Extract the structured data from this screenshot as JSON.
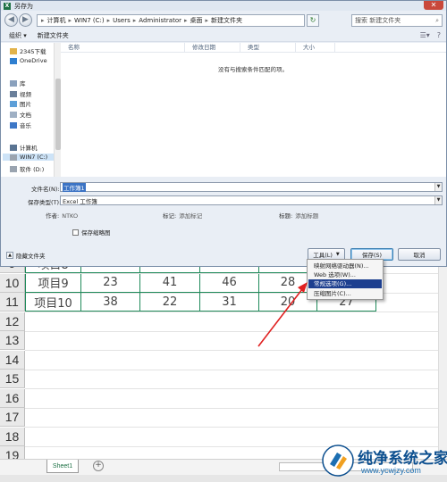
{
  "dialog": {
    "title": "另存为",
    "close_glyph": "✕",
    "address": [
      "计算机",
      "WIN7 (C:)",
      "Users",
      "Administrator",
      "桌面",
      "新建文件夹"
    ],
    "search_placeholder": "搜索 新建文件夹",
    "toolbar": {
      "organize": "组织 ▾",
      "new_folder": "新建文件夹"
    },
    "nav_items": [
      {
        "label": "2345下载",
        "icon": "folder-icon"
      },
      {
        "label": "OneDrive",
        "icon": "cloud-icon"
      },
      {
        "label": "库",
        "icon": "library-icon"
      },
      {
        "label": "视频",
        "icon": "video-icon"
      },
      {
        "label": "图片",
        "icon": "picture-icon"
      },
      {
        "label": "文档",
        "icon": "document-icon"
      },
      {
        "label": "音乐",
        "icon": "music-icon"
      },
      {
        "label": "计算机",
        "icon": "computer-icon"
      },
      {
        "label": "WIN7 (C:)",
        "icon": "drive-icon"
      },
      {
        "label": "软件 (D:)",
        "icon": "drive-icon"
      }
    ],
    "columns": [
      "名称",
      "修改日期",
      "类型",
      "大小"
    ],
    "empty_message": "没有与搜索条件匹配的项。",
    "filename_label": "文件名(N):",
    "filename_value": "工作簿1",
    "filetype_label": "保存类型(T):",
    "filetype_value": "Excel 工作簿",
    "author_label": "作者:",
    "author_value": "NTKO",
    "tags_label": "标记:",
    "tags_value": "添加标记",
    "titlemeta_label": "标题:",
    "titlemeta_value": "添加标题",
    "thumbnail_label": "保存缩略图",
    "hide_folders": "隐藏文件夹",
    "tools_button": "工具(L)",
    "save_button": "保存(S)",
    "cancel_button": "取消"
  },
  "tools_menu": [
    "映射网络驱动器(N)...",
    "Web 选项(W)...",
    "常规选项(G)...",
    "压缩图片(C)..."
  ],
  "sheet": {
    "rows": [
      {
        "num": "9",
        "cells": [
          "项目8",
          "41",
          "32",
          "25",
          "31"
        ]
      },
      {
        "num": "10",
        "cells": [
          "项目9",
          "23",
          "41",
          "46",
          "28"
        ]
      },
      {
        "num": "11",
        "cells": [
          "项目10",
          "38",
          "22",
          "31",
          "20",
          "27"
        ]
      },
      {
        "num": "12",
        "cells": []
      },
      {
        "num": "13",
        "cells": []
      },
      {
        "num": "14",
        "cells": []
      },
      {
        "num": "15",
        "cells": []
      },
      {
        "num": "16",
        "cells": []
      },
      {
        "num": "17",
        "cells": []
      },
      {
        "num": "18",
        "cells": []
      },
      {
        "num": "19",
        "cells": []
      }
    ],
    "tab_name": "Sheet1",
    "add_sheet_glyph": "+"
  },
  "watermark": {
    "name": "纯净系统之家",
    "url": "www.ycwjzy.com"
  }
}
